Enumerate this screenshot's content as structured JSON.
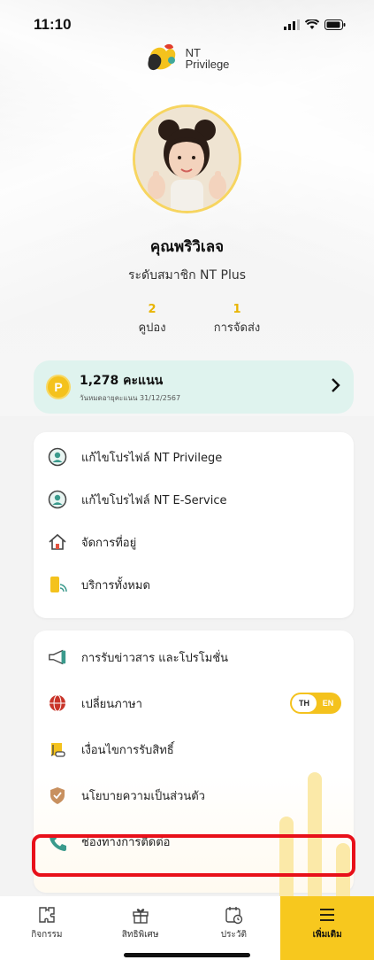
{
  "status_bar": {
    "time": "11:10"
  },
  "brand": {
    "line1": "NT",
    "line2": "Privilege"
  },
  "profile": {
    "name": "คุณพริวิเลจ",
    "level": "ระดับสมาชิก NT Plus"
  },
  "stats": [
    {
      "value": "2",
      "label": "คูปอง"
    },
    {
      "value": "1",
      "label": "การจัดส่ง"
    }
  ],
  "points": {
    "coin_letter": "P",
    "amount": "1,278 คะแนน",
    "expiry": "วันหมดอายุคะแนน 31/12/2567"
  },
  "menu_group_1": [
    {
      "label": "แก้ไขโปรไฟล์ NT Privilege",
      "icon": "user-circle-icon"
    },
    {
      "label": "แก้ไขโปรไฟล์ NT E-Service",
      "icon": "user-circle-icon"
    },
    {
      "label": "จัดการที่อยู่",
      "icon": "home-icon"
    },
    {
      "label": "บริการทั้งหมด",
      "icon": "phone-signal-icon"
    }
  ],
  "menu_group_2": [
    {
      "label": "การรับข่าวสาร และโปรโมชั่น",
      "icon": "megaphone-icon"
    },
    {
      "label": "เปลี่ยนภาษา",
      "icon": "globe-icon"
    },
    {
      "label": "เงื่อนไขการรับสิทธิ์",
      "icon": "scroll-icon"
    },
    {
      "label": "นโยบายความเป็นส่วนตัว",
      "icon": "shield-icon"
    },
    {
      "label": "ช่องทางการติดต่อ",
      "icon": "phone-icon"
    }
  ],
  "language_toggle": {
    "th": "TH",
    "en": "EN",
    "selected": "TH"
  },
  "tabs": [
    {
      "label": "กิจกรรม",
      "icon": "puzzle-icon",
      "active": false
    },
    {
      "label": "สิทธิพิเศษ",
      "icon": "gift-icon",
      "active": false
    },
    {
      "label": "ประวัติ",
      "icon": "calendar-history-icon",
      "active": false
    },
    {
      "label": "เพิ่มเติม",
      "icon": "menu-icon",
      "active": true
    }
  ],
  "colors": {
    "accent_yellow": "#F7C81E",
    "points_card_bg": "#DFF3EE",
    "highlight_red": "#E8101A",
    "icon_teal": "#3A9A8C"
  }
}
